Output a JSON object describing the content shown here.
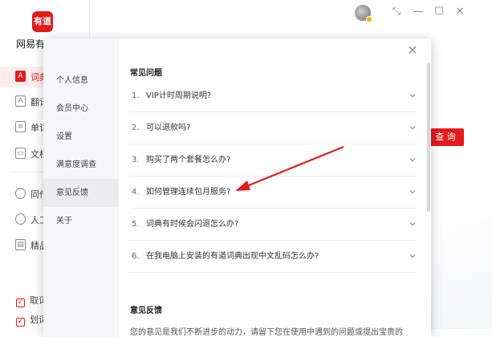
{
  "app": {
    "logo_text": "有道",
    "name": "网易有道词典",
    "query_button": "查 询"
  },
  "sidebar": {
    "items": [
      {
        "label": "词典",
        "icon": "dictionary-icon",
        "active": true
      },
      {
        "label": "翻译",
        "icon": "translate-icon",
        "active": false
      },
      {
        "label": "单词本",
        "icon": "wordbook-icon",
        "active": false
      },
      {
        "label": "文档翻译",
        "icon": "document-icon",
        "active": false
      },
      {
        "label": "同传",
        "icon": "globe-icon",
        "active": false
      },
      {
        "label": "人工翻译",
        "icon": "person-icon",
        "active": false
      },
      {
        "label": "精品课",
        "icon": "course-icon",
        "active": false
      }
    ],
    "checkboxes": [
      {
        "label": "取词",
        "checked": true
      },
      {
        "label": "划词",
        "checked": true
      }
    ]
  },
  "window": {
    "avatar_icon": "user-avatar",
    "restore_icon": "shrink-icon",
    "minimize_icon": "minimize-icon",
    "maximize_icon": "maximize-icon",
    "close_icon": "close-icon"
  },
  "dialog": {
    "nav": [
      {
        "label": "个人信息",
        "active": false
      },
      {
        "label": "会员中心",
        "active": false
      },
      {
        "label": "设置",
        "active": false
      },
      {
        "label": "满意度调查",
        "active": false
      },
      {
        "label": "意见反馈",
        "active": true
      },
      {
        "label": "关于",
        "active": false
      }
    ],
    "faq_title": "常见问题",
    "faq": [
      {
        "num": "1.",
        "question": "VIP计时周期说明?"
      },
      {
        "num": "2.",
        "question": "可以退款吗?"
      },
      {
        "num": "3.",
        "question": "购买了两个套餐怎么办?"
      },
      {
        "num": "4.",
        "question": "如何管理连续包月服务?"
      },
      {
        "num": "5.",
        "question": "词典有时候会闪退怎么办?"
      },
      {
        "num": "6.",
        "question": "在我电脑上安装的有道词典出现中文乱码怎么办?"
      }
    ],
    "feedback_title": "意见反馈",
    "feedback_desc": "您的意见是我们不断进步的动力，请留下您在使用中遇到的问题或提出宝贵的"
  },
  "colors": {
    "accent": "#e21c1c",
    "annotation_arrow": "#e21c1c"
  }
}
